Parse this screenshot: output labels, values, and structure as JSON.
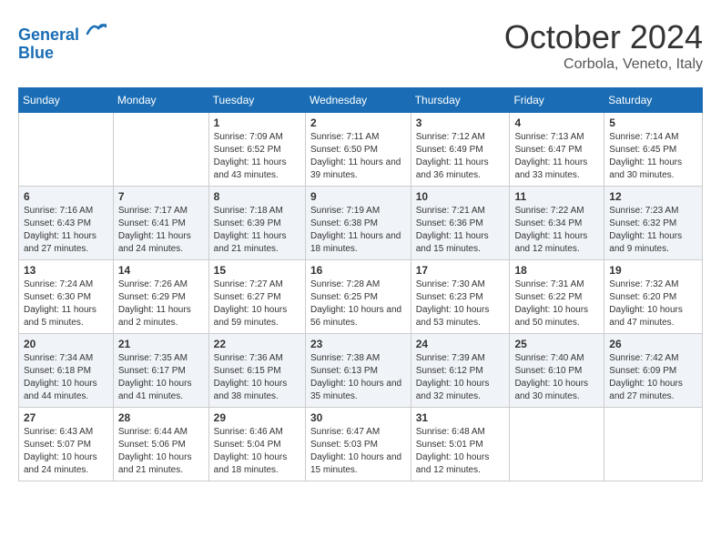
{
  "header": {
    "logo_line1": "General",
    "logo_line2": "Blue",
    "month_title": "October 2024",
    "subtitle": "Corbola, Veneto, Italy"
  },
  "weekdays": [
    "Sunday",
    "Monday",
    "Tuesday",
    "Wednesday",
    "Thursday",
    "Friday",
    "Saturday"
  ],
  "weeks": [
    [
      {
        "day": "",
        "content": ""
      },
      {
        "day": "",
        "content": ""
      },
      {
        "day": "1",
        "content": "Sunrise: 7:09 AM\nSunset: 6:52 PM\nDaylight: 11 hours and 43 minutes."
      },
      {
        "day": "2",
        "content": "Sunrise: 7:11 AM\nSunset: 6:50 PM\nDaylight: 11 hours and 39 minutes."
      },
      {
        "day": "3",
        "content": "Sunrise: 7:12 AM\nSunset: 6:49 PM\nDaylight: 11 hours and 36 minutes."
      },
      {
        "day": "4",
        "content": "Sunrise: 7:13 AM\nSunset: 6:47 PM\nDaylight: 11 hours and 33 minutes."
      },
      {
        "day": "5",
        "content": "Sunrise: 7:14 AM\nSunset: 6:45 PM\nDaylight: 11 hours and 30 minutes."
      }
    ],
    [
      {
        "day": "6",
        "content": "Sunrise: 7:16 AM\nSunset: 6:43 PM\nDaylight: 11 hours and 27 minutes."
      },
      {
        "day": "7",
        "content": "Sunrise: 7:17 AM\nSunset: 6:41 PM\nDaylight: 11 hours and 24 minutes."
      },
      {
        "day": "8",
        "content": "Sunrise: 7:18 AM\nSunset: 6:39 PM\nDaylight: 11 hours and 21 minutes."
      },
      {
        "day": "9",
        "content": "Sunrise: 7:19 AM\nSunset: 6:38 PM\nDaylight: 11 hours and 18 minutes."
      },
      {
        "day": "10",
        "content": "Sunrise: 7:21 AM\nSunset: 6:36 PM\nDaylight: 11 hours and 15 minutes."
      },
      {
        "day": "11",
        "content": "Sunrise: 7:22 AM\nSunset: 6:34 PM\nDaylight: 11 hours and 12 minutes."
      },
      {
        "day": "12",
        "content": "Sunrise: 7:23 AM\nSunset: 6:32 PM\nDaylight: 11 hours and 9 minutes."
      }
    ],
    [
      {
        "day": "13",
        "content": "Sunrise: 7:24 AM\nSunset: 6:30 PM\nDaylight: 11 hours and 5 minutes."
      },
      {
        "day": "14",
        "content": "Sunrise: 7:26 AM\nSunset: 6:29 PM\nDaylight: 11 hours and 2 minutes."
      },
      {
        "day": "15",
        "content": "Sunrise: 7:27 AM\nSunset: 6:27 PM\nDaylight: 10 hours and 59 minutes."
      },
      {
        "day": "16",
        "content": "Sunrise: 7:28 AM\nSunset: 6:25 PM\nDaylight: 10 hours and 56 minutes."
      },
      {
        "day": "17",
        "content": "Sunrise: 7:30 AM\nSunset: 6:23 PM\nDaylight: 10 hours and 53 minutes."
      },
      {
        "day": "18",
        "content": "Sunrise: 7:31 AM\nSunset: 6:22 PM\nDaylight: 10 hours and 50 minutes."
      },
      {
        "day": "19",
        "content": "Sunrise: 7:32 AM\nSunset: 6:20 PM\nDaylight: 10 hours and 47 minutes."
      }
    ],
    [
      {
        "day": "20",
        "content": "Sunrise: 7:34 AM\nSunset: 6:18 PM\nDaylight: 10 hours and 44 minutes."
      },
      {
        "day": "21",
        "content": "Sunrise: 7:35 AM\nSunset: 6:17 PM\nDaylight: 10 hours and 41 minutes."
      },
      {
        "day": "22",
        "content": "Sunrise: 7:36 AM\nSunset: 6:15 PM\nDaylight: 10 hours and 38 minutes."
      },
      {
        "day": "23",
        "content": "Sunrise: 7:38 AM\nSunset: 6:13 PM\nDaylight: 10 hours and 35 minutes."
      },
      {
        "day": "24",
        "content": "Sunrise: 7:39 AM\nSunset: 6:12 PM\nDaylight: 10 hours and 32 minutes."
      },
      {
        "day": "25",
        "content": "Sunrise: 7:40 AM\nSunset: 6:10 PM\nDaylight: 10 hours and 30 minutes."
      },
      {
        "day": "26",
        "content": "Sunrise: 7:42 AM\nSunset: 6:09 PM\nDaylight: 10 hours and 27 minutes."
      }
    ],
    [
      {
        "day": "27",
        "content": "Sunrise: 6:43 AM\nSunset: 5:07 PM\nDaylight: 10 hours and 24 minutes."
      },
      {
        "day": "28",
        "content": "Sunrise: 6:44 AM\nSunset: 5:06 PM\nDaylight: 10 hours and 21 minutes."
      },
      {
        "day": "29",
        "content": "Sunrise: 6:46 AM\nSunset: 5:04 PM\nDaylight: 10 hours and 18 minutes."
      },
      {
        "day": "30",
        "content": "Sunrise: 6:47 AM\nSunset: 5:03 PM\nDaylight: 10 hours and 15 minutes."
      },
      {
        "day": "31",
        "content": "Sunrise: 6:48 AM\nSunset: 5:01 PM\nDaylight: 10 hours and 12 minutes."
      },
      {
        "day": "",
        "content": ""
      },
      {
        "day": "",
        "content": ""
      }
    ]
  ]
}
